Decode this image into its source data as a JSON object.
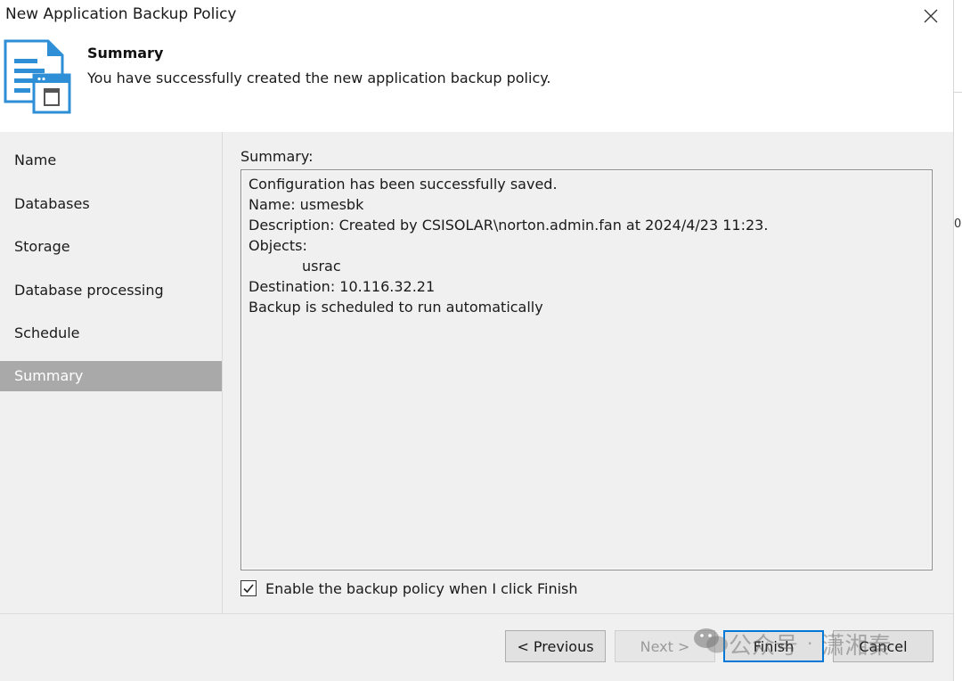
{
  "window": {
    "title": "New Application Backup Policy",
    "close_icon": "close-icon"
  },
  "header": {
    "title": "Summary",
    "subtitle": "You have successfully created the new application backup policy.",
    "icon": "summary-document-icon"
  },
  "nav": {
    "items": [
      {
        "label": "Name",
        "active": false
      },
      {
        "label": "Databases",
        "active": false
      },
      {
        "label": "Storage",
        "active": false
      },
      {
        "label": "Database processing",
        "active": false
      },
      {
        "label": "Schedule",
        "active": false
      },
      {
        "label": "Summary",
        "active": true
      }
    ]
  },
  "summary": {
    "label": "Summary:",
    "lines": [
      "Configuration has been successfully saved.",
      "Name: usmesbk",
      "Description: Created by CSISOLAR\\norton.admin.fan at 2024/4/23 11:23.",
      "Objects:",
      "usrac",
      "Destination: 10.116.32.21",
      "Backup is scheduled to run automatically"
    ]
  },
  "enable_checkbox": {
    "checked": true,
    "label": "Enable the backup policy when I click Finish"
  },
  "buttons": {
    "previous": "< Previous",
    "next": "Next >",
    "finish": "Finish",
    "cancel": "Cancel"
  },
  "background_fragment": "0",
  "watermark": {
    "icon": "wechat-icon",
    "text1": "公众号",
    "separator": "·",
    "text2": "潇湘秦"
  },
  "colors": {
    "active_nav": "#a9a9a9",
    "panel_bg": "#f0f0f0",
    "primary_border": "#0078d7",
    "icon_blue": "#2e8fd6"
  }
}
